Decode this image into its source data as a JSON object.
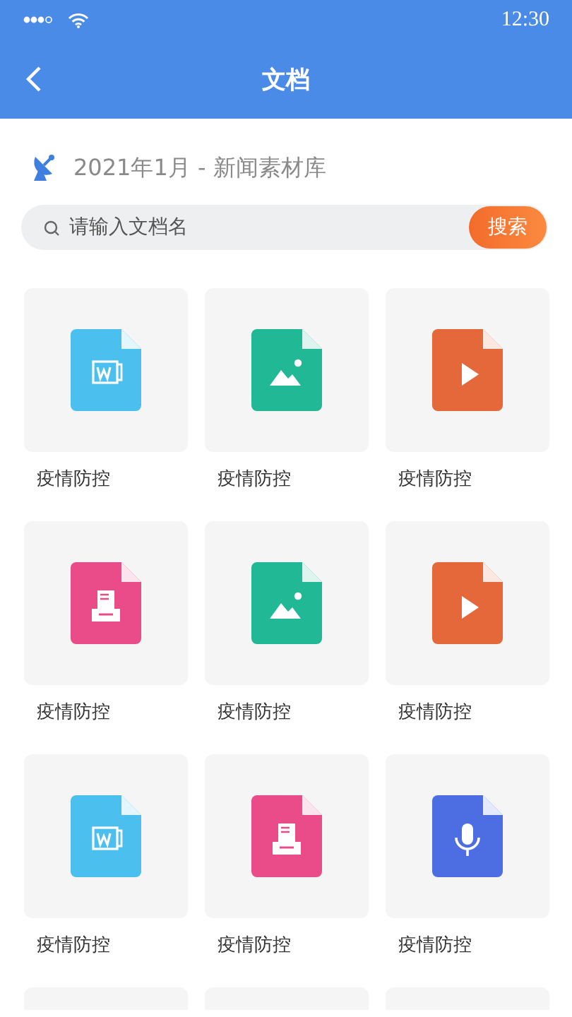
{
  "status_bar": {
    "time": "12:30"
  },
  "header": {
    "title": "文档"
  },
  "breadcrumb": {
    "text": "2021年1月 - 新闻素材库"
  },
  "search": {
    "placeholder": "请输入文档名",
    "button": "搜索"
  },
  "files": [
    {
      "kind": "word",
      "label": "疫情防控"
    },
    {
      "kind": "image",
      "label": "疫情防控"
    },
    {
      "kind": "video",
      "label": "疫情防控"
    },
    {
      "kind": "archive",
      "label": "疫情防控"
    },
    {
      "kind": "image",
      "label": "疫情防控"
    },
    {
      "kind": "video",
      "label": "疫情防控"
    },
    {
      "kind": "word",
      "label": "疫情防控"
    },
    {
      "kind": "archive",
      "label": "疫情防控"
    },
    {
      "kind": "audio",
      "label": "疫情防控"
    }
  ],
  "more_cards_below": true
}
